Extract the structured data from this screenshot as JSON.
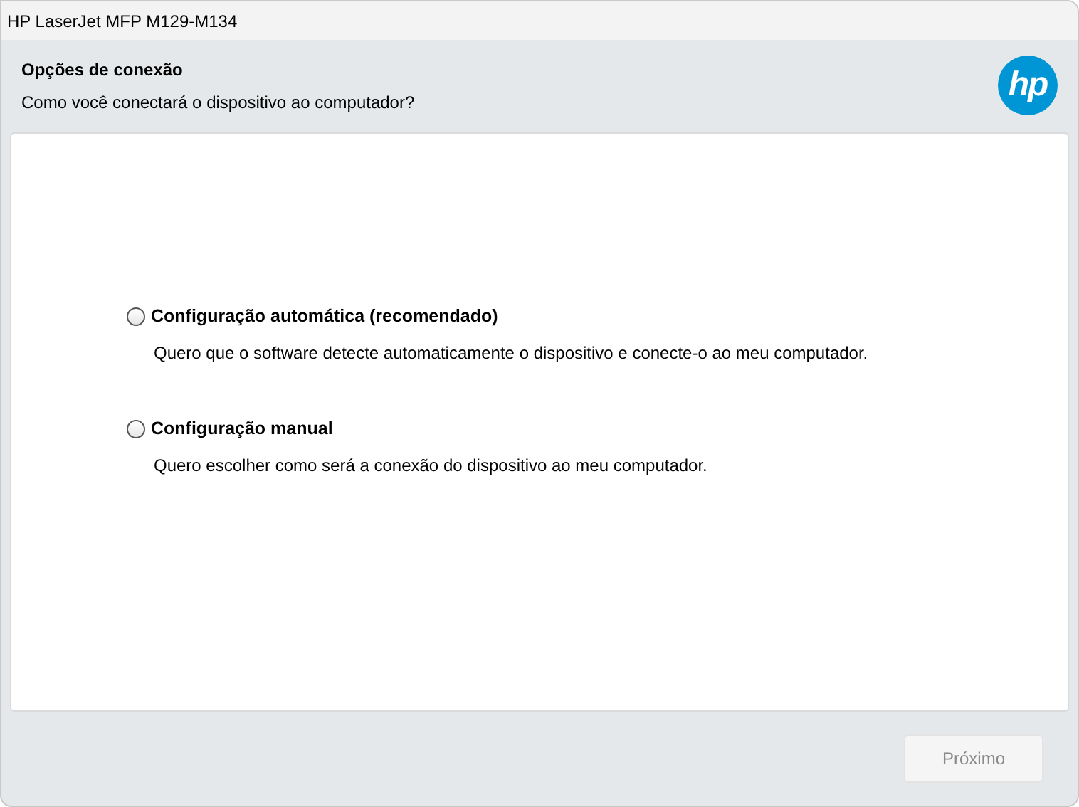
{
  "window": {
    "title": "HP LaserJet MFP M129-M134"
  },
  "header": {
    "title": "Opções de conexão",
    "subtitle": "Como você conectará o dispositivo ao computador?",
    "logo": "hp"
  },
  "options": [
    {
      "label": "Configuração automática (recomendado)",
      "description": "Quero que o software detecte automaticamente o dispositivo e conecte-o ao meu computador.",
      "selected": false
    },
    {
      "label": "Configuração manual",
      "description": "Quero escolher como será a conexão do dispositivo ao meu computador.",
      "selected": false
    }
  ],
  "buttons": [
    {
      "label": "Próximo",
      "disabled": true
    }
  ]
}
